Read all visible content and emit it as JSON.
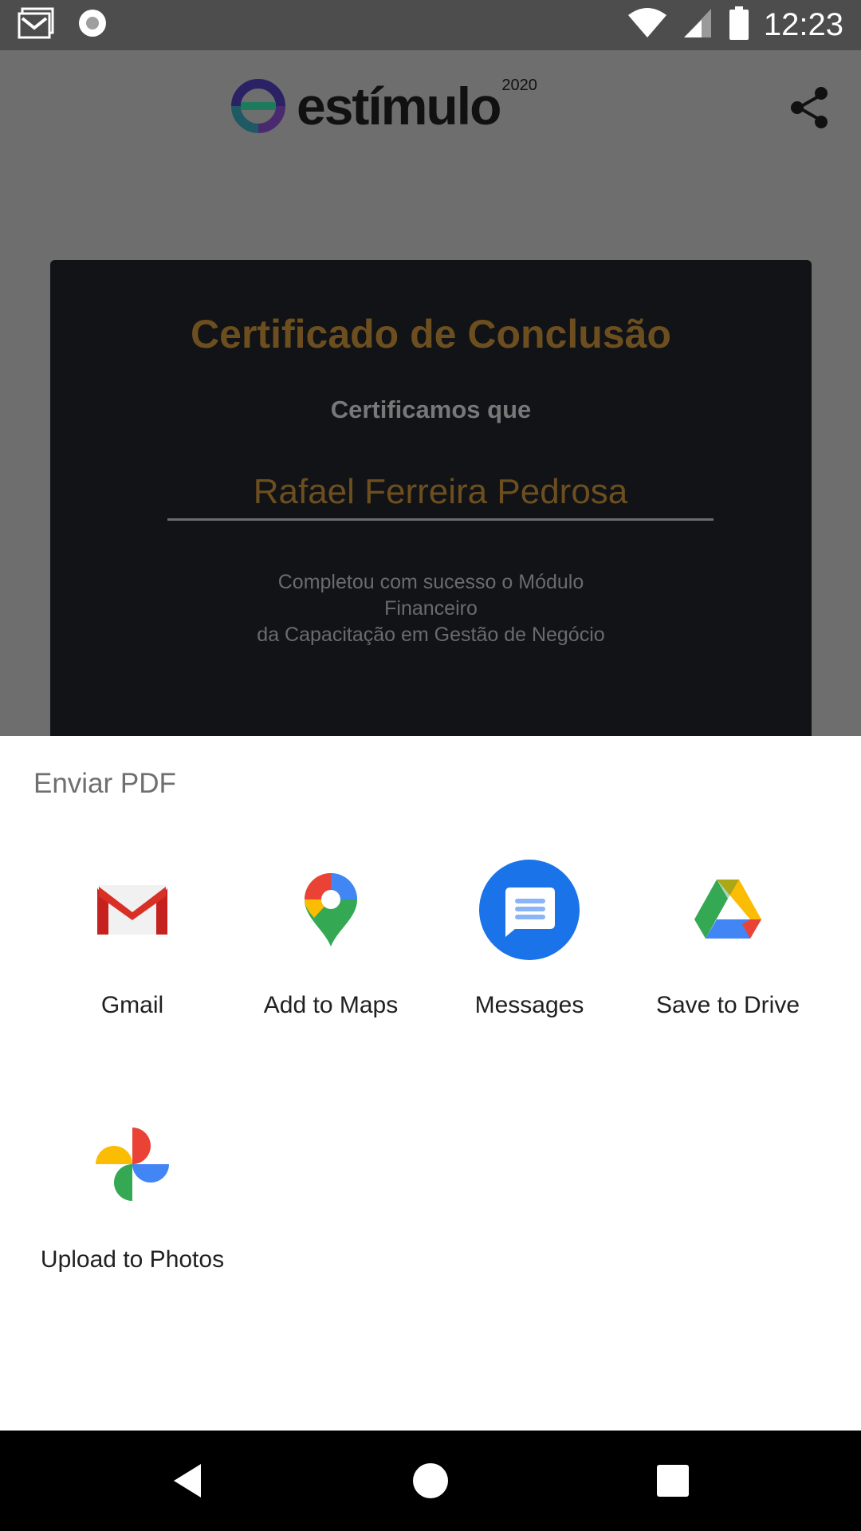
{
  "status_bar": {
    "time": "12:23",
    "left_icons": [
      "gmail-notification-icon",
      "record-icon"
    ],
    "right_icons": [
      "wifi-icon",
      "signal-icon",
      "battery-icon"
    ]
  },
  "header": {
    "logo_text": "estímulo",
    "logo_year": "2020",
    "share_icon": "share-icon"
  },
  "certificate": {
    "title": "Certificado de Conclusão",
    "subtitle": "Certificamos que",
    "name": "Rafael Ferreira Pedrosa",
    "desc_line1": "Completou com sucesso o Módulo",
    "desc_line2": "Financeiro",
    "desc_line3": "da Capacitação em Gestão de Negócio"
  },
  "share_sheet": {
    "title": "Enviar PDF",
    "targets": [
      {
        "label": "Gmail",
        "icon": "gmail-icon"
      },
      {
        "label": "Add to Maps",
        "icon": "maps-icon"
      },
      {
        "label": "Messages",
        "icon": "messages-icon"
      },
      {
        "label": "Save to Drive",
        "icon": "drive-icon"
      },
      {
        "label": "Upload to Photos",
        "icon": "photos-icon"
      }
    ]
  },
  "nav_bar": {
    "buttons": [
      "back-icon",
      "home-icon",
      "recents-icon"
    ]
  },
  "colors": {
    "scrim": "#6e6e6e",
    "status_bar": "#4d4d4d",
    "certificate_bg": "#111317",
    "gold_dimmed": "#6d4f1f",
    "messages_blue": "#1a73e8"
  }
}
